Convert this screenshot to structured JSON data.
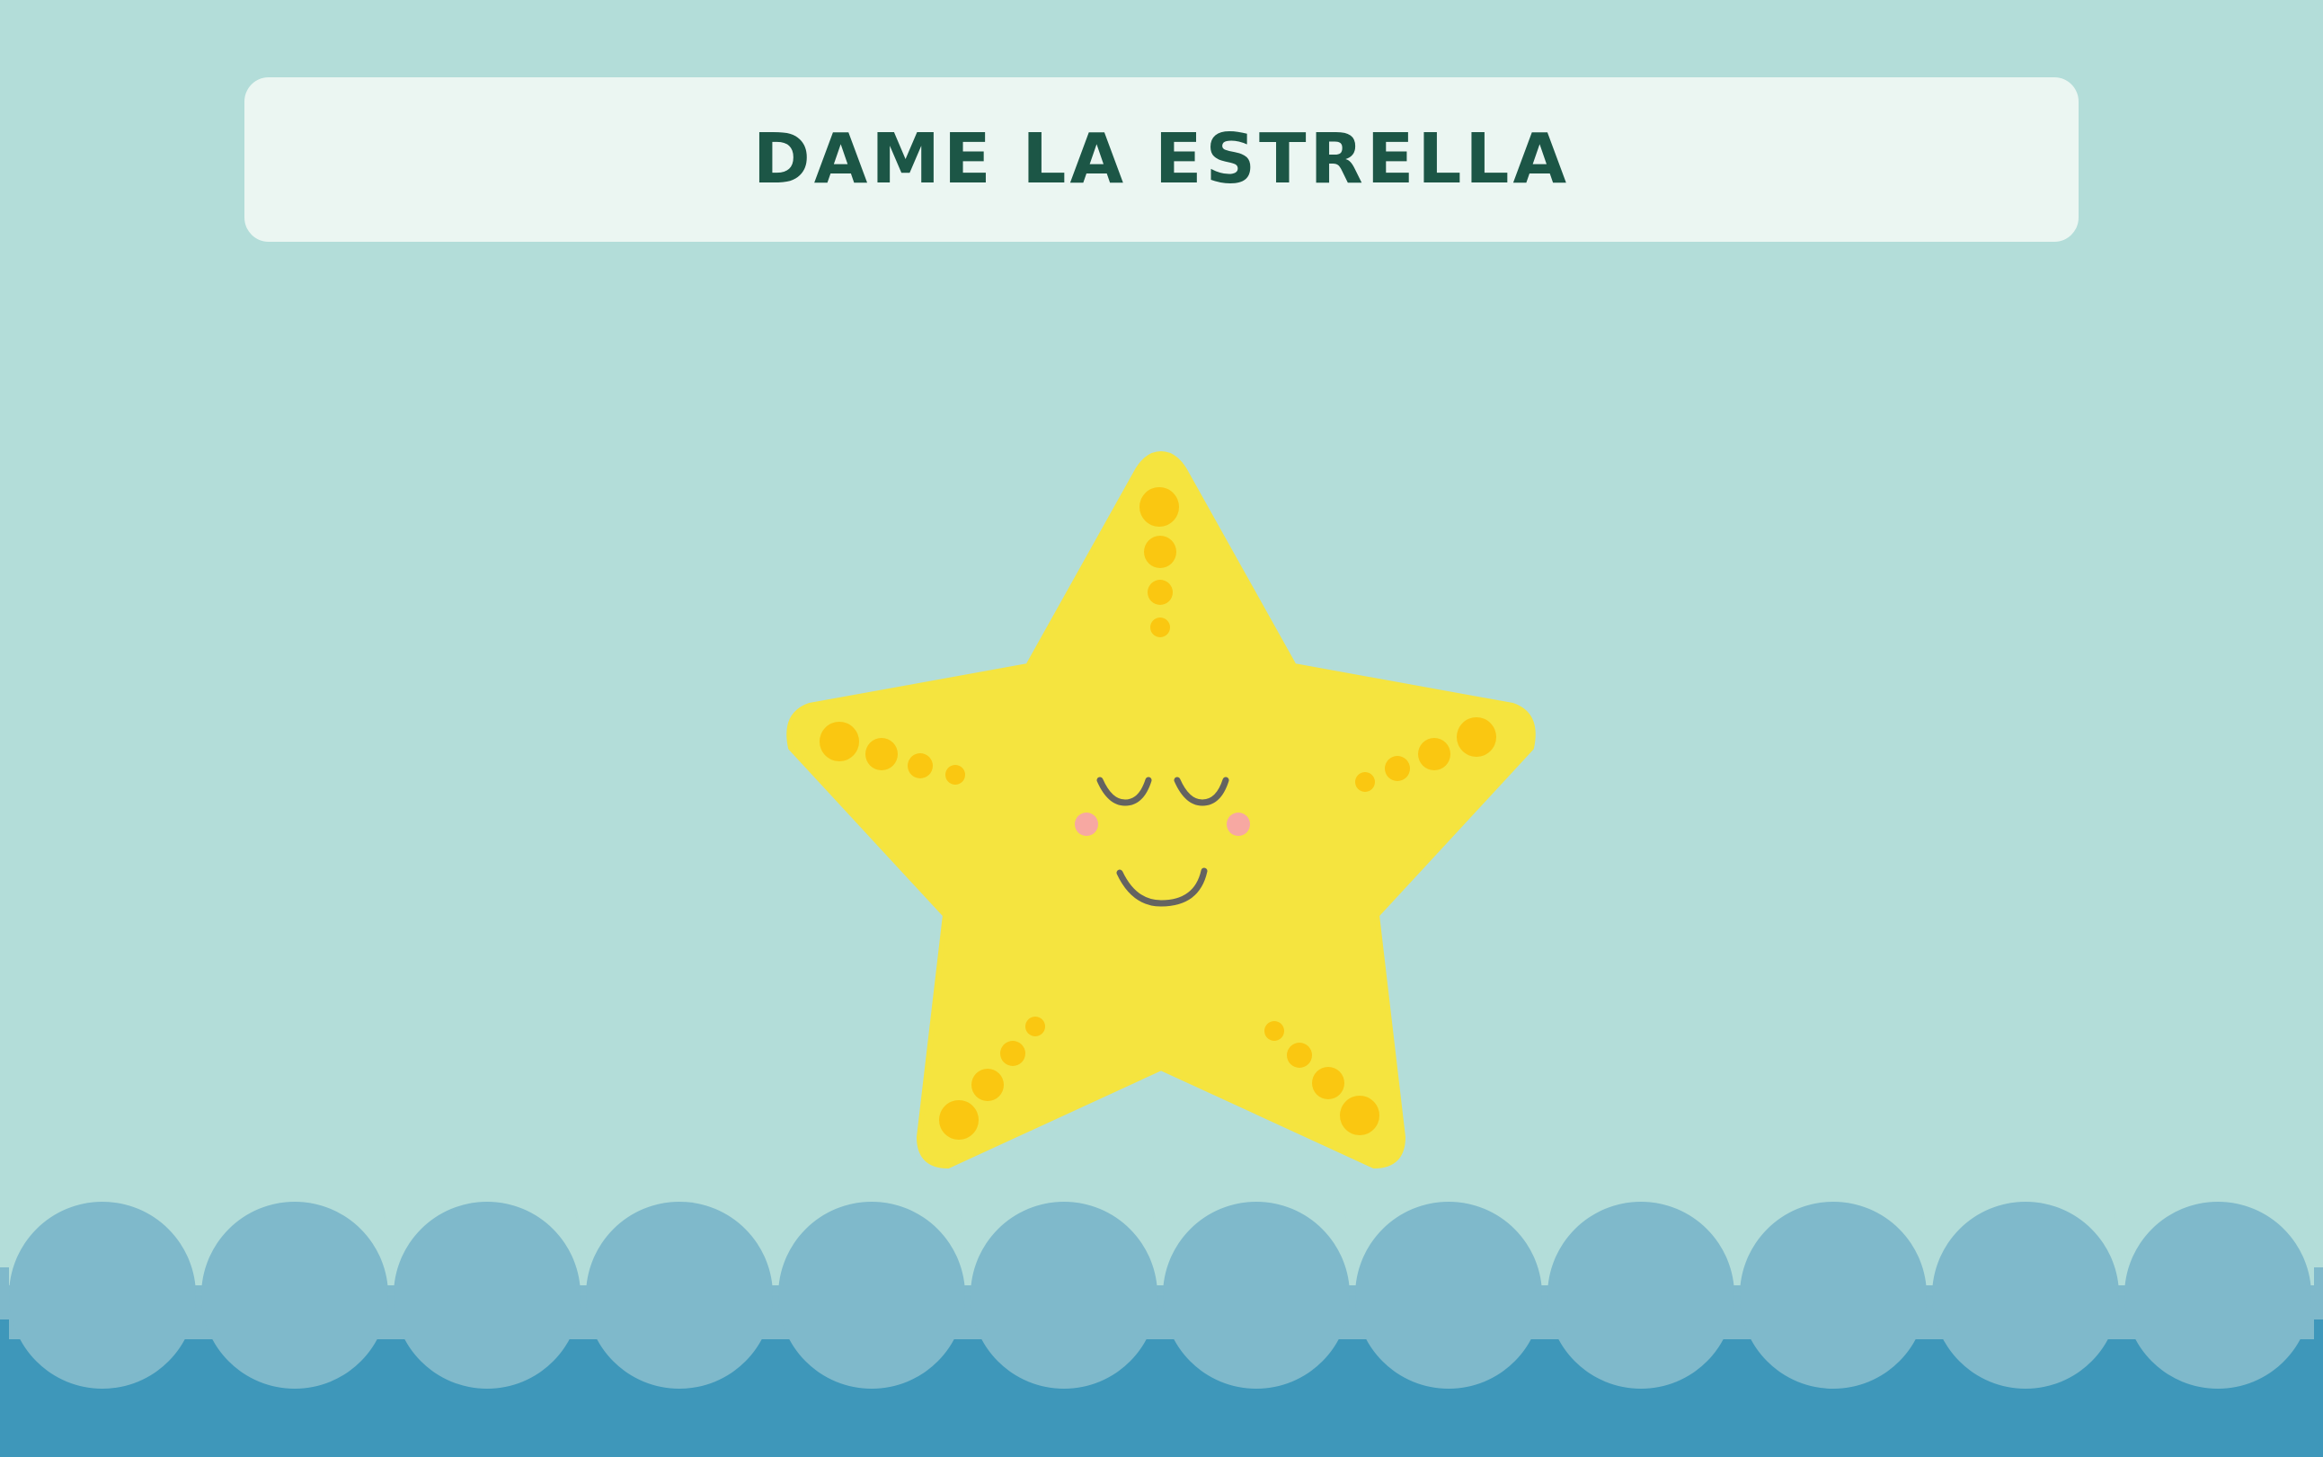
{
  "title": "DAME LA ESTRELLA",
  "icons": {
    "starfish": "starfish-character-icon",
    "waves": "ocean-waves"
  },
  "colors": {
    "background": "#b3ddd9",
    "banner": "#ebf6f2",
    "title_text": "#1c5646",
    "star_body": "#f5e43f",
    "star_spots": "#fac711",
    "face_lines": "#646361",
    "cheeks": "#f7a8a2",
    "wave_light": "#7fb9cb",
    "wave_dark": "#3e97ba"
  }
}
